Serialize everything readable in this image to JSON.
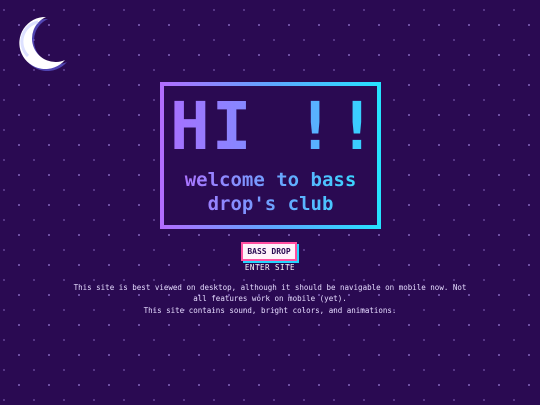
{
  "moon": {
    "icon": "crescent-moon-icon",
    "color": "#ffffff",
    "shadow_color": "#6f74ff"
  },
  "hero": {
    "greeting": "HI !!!",
    "welcome_line1": "welcome to bass",
    "welcome_line2": "drop's club",
    "gradient_start": "#b36cff",
    "gradient_end": "#25e3ff"
  },
  "enter": {
    "logo_text": "BASS DROP",
    "label": "ENTER SITE",
    "logo_border": "#ff4fa0",
    "logo_shadow": "#23d6ff"
  },
  "notices": {
    "desktop": "This site is best viewed on desktop, although it should be navigable on mobile now. Not all features work on mobile (yet).",
    "content": "This site contains sound, bright colors, and animations."
  },
  "colors": {
    "background": "#2a0a52",
    "text": "#e6dcff"
  }
}
